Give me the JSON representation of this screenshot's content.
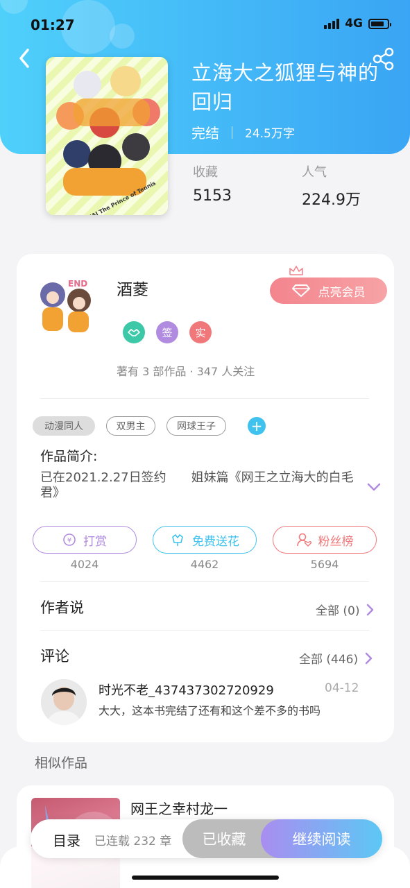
{
  "status_bar": {
    "time": "01:27",
    "network": "4G"
  },
  "book": {
    "title": "立海大之狐狸与神的回归",
    "status": "完结",
    "word_count": "24.5万字",
    "cover_text": "RIKKAI The Prince of Tennis"
  },
  "stats": {
    "favorites_label": "收藏",
    "favorites_value": "5153",
    "popularity_label": "人气",
    "popularity_value": "224.9万"
  },
  "author": {
    "name": "酒菱",
    "vip_button": "点亮会员",
    "badges": [
      "签",
      "实"
    ],
    "summary": "著有 3 部作品 · 347 人关注"
  },
  "tags": [
    "动漫同人",
    "双男主",
    "网球王子"
  ],
  "intro": {
    "title": "作品简介:",
    "text": "已在2021.2.27日签约　　姐妹篇《网王之立海大的白毛君》"
  },
  "actions": [
    {
      "label": "打赏",
      "count": "4024"
    },
    {
      "label": "免费送花",
      "count": "4462"
    },
    {
      "label": "粉丝榜",
      "count": "5694"
    }
  ],
  "author_says": {
    "title": "作者说",
    "link": "全部 (0)"
  },
  "comments": {
    "title": "评论",
    "link": "全部 (446)",
    "first": {
      "user": "时光不老_437437302720929",
      "date": "04-12",
      "text": "大大，这本书完结了还有和这个差不多的书吗"
    }
  },
  "similar": {
    "title": "相似作品",
    "first_name": "网王之幸村龙一"
  },
  "bottom_bar": {
    "toc": "目录",
    "serial": "已连载 232 章",
    "favorited": "已收藏",
    "continue_reading": "继续阅读"
  },
  "colors": {
    "header_start": "#4fd0fb",
    "header_end": "#3aa5f4",
    "vip": "#f3848d",
    "accent_purple": "#b08be0",
    "accent_cyan": "#3fc2ee",
    "accent_red": "#f0787b"
  }
}
